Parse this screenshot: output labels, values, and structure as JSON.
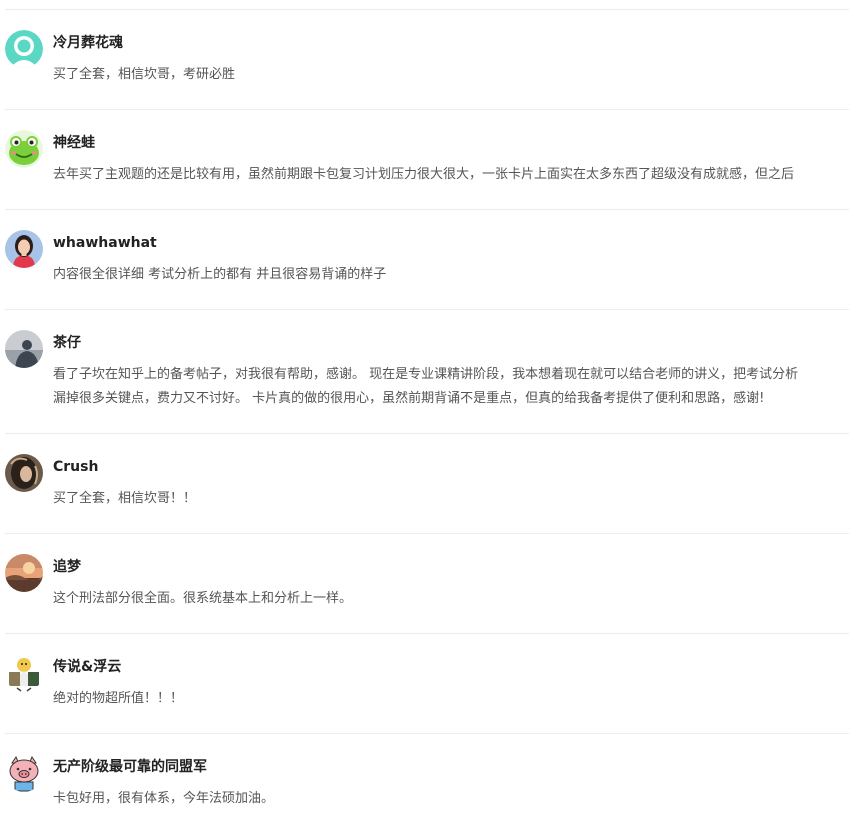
{
  "comments": [
    {
      "name": "冷月葬花魂",
      "avatar": "default-person-avatar",
      "lines": [
        "买了全套，相信坎哥，考研必胜"
      ]
    },
    {
      "name": "神经蛙",
      "avatar": "green-frog-avatar",
      "lines": [
        "去年买了主观题的还是比较有用，虽然前期跟卡包复习计划压力很大很大，一张卡片上面实在太多东西了超级没有成就感，但之后"
      ]
    },
    {
      "name": "whawhawhat",
      "avatar": "girl-photo-avatar",
      "lines": [
        "内容很全很详细 考试分析上的都有 并且很容易背诵的样子"
      ]
    },
    {
      "name": "茶仔",
      "avatar": "silhouette-photo-avatar",
      "lines": [
        "看了子坎在知乎上的备考帖子，对我很有帮助，感谢。 现在是专业课精讲阶段，我本想着现在就可以结合老师的讲义，把考试分析",
        "漏掉很多关键点，费力又不讨好。 卡片真的做的很用心，虽然前期背诵不是重点，但真的给我备考提供了便利和思路，感谢!"
      ]
    },
    {
      "name": "Crush",
      "avatar": "hair-photo-avatar",
      "lines": [
        "买了全套，相信坎哥！！"
      ]
    },
    {
      "name": "追梦",
      "avatar": "sunset-photo-avatar",
      "lines": [
        "这个刑法部分很全面。很系统基本上和分析上一样。"
      ]
    },
    {
      "name": "传说&浮云",
      "avatar": "cartoon-reading-avatar",
      "lines": [
        "绝对的物超所值！！！"
      ]
    },
    {
      "name": "无产阶级最可靠的同盟军",
      "avatar": "pink-pig-avatar",
      "lines": [
        "卡包好用，很有体系，今年法硕加油。"
      ]
    }
  ],
  "colors": {
    "divider": "#ececec",
    "name_text": "#222222",
    "body_text": "#555555",
    "default_avatar": "#5ad8c4",
    "frog_green": "#7ccf3c",
    "pig_pink": "#f5b1b8"
  }
}
